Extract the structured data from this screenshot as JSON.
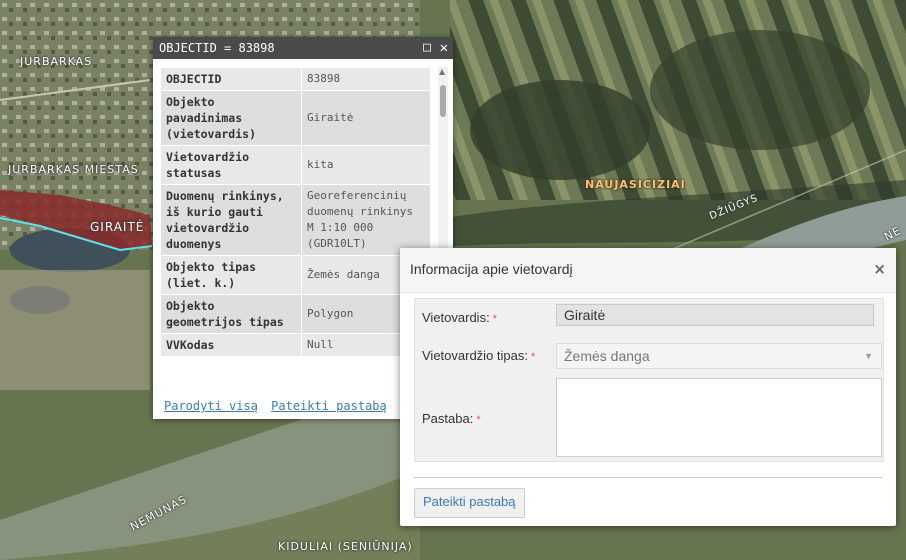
{
  "map": {
    "labels": {
      "jurbarkas_top": "JURBARKAS",
      "jurbarkas_miestas": "JURBARKAS  MIESTAS",
      "giraite": "GIRAITĖ",
      "nau_jasiciziai": "NAUJASICIZIAI",
      "dziugys": "DŽIŪGYS",
      "nemunas_left": "NEMUNAS",
      "kidulai": "KIDULIAI (SENIŪNIJA)",
      "right_edge": "NE"
    }
  },
  "popup": {
    "title": "OBJECTID = 83898",
    "maximize_icon": "maximize-icon",
    "close_icon": "close-icon",
    "rows": [
      {
        "key": "OBJECTID",
        "value": "83898"
      },
      {
        "key": "Objekto pavadinimas (vietovardis)",
        "value": "Giraitė"
      },
      {
        "key": "Vietovardžio statusas",
        "value": "kita"
      },
      {
        "key": "Duomenų rinkinys, iš kurio gauti vietovardžio duomenys",
        "value": "Georeferencinių duomenų rinkinys M 1:10 000 (GDR10LT)"
      },
      {
        "key": "Objekto tipas (liet. k.)",
        "value": "Žemės danga"
      },
      {
        "key": "Objekto geometrijos tipas",
        "value": "Polygon"
      },
      {
        "key": "VVKodas",
        "value": "Null"
      }
    ],
    "links": {
      "show_all": "Parodyti visą",
      "submit_note": "Pateikti pastabą"
    }
  },
  "dialog": {
    "title": "Informacija apie vietovardį",
    "close_glyph": "×",
    "fields": {
      "vietovardis_label": "Vietovardis:",
      "vietovardis_value": "Giraitė",
      "tipas_label": "Vietovardžio tipas:",
      "tipas_value": "Žemės danga",
      "pastaba_label": "Pastaba:",
      "required_mark": "*"
    },
    "submit_label": "Pateikti pastabą"
  },
  "colors": {
    "accent_link": "#3b7ab8",
    "required": "#d9534f",
    "popup_header": "#4a4a4a",
    "polygon_fill": "#8a2a2a",
    "polygon_outline": "#5ee0e8"
  }
}
